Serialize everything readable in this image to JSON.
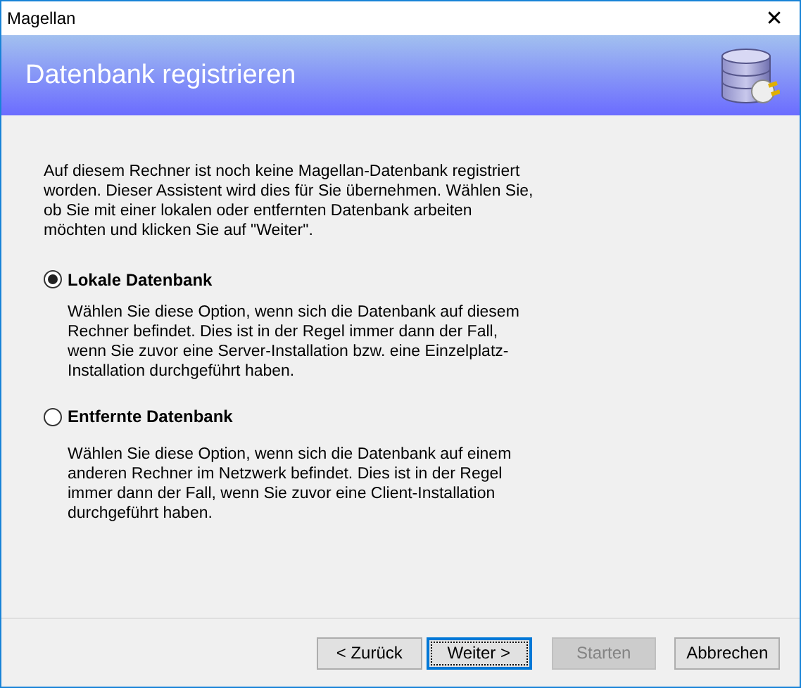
{
  "window": {
    "title": "Magellan",
    "close": "✕"
  },
  "header": {
    "title": "Datenbank registrieren"
  },
  "intro": "Auf diesem Rechner ist noch keine Magellan-Datenbank registriert worden. Dieser Assistent wird dies für Sie übernehmen. Wählen Sie, ob Sie mit einer lokalen oder entfernten Datenbank arbeiten möchten und klicken Sie auf \"Weiter\".",
  "options": [
    {
      "label": "Lokale Datenbank",
      "selected": true,
      "description": "Wählen Sie diese Option, wenn sich die Datenbank auf diesem Rechner befindet. Dies ist in der Regel immer dann der Fall, wenn Sie zuvor eine Server-Installation bzw. eine Einzelplatz-Installation durchgeführt haben."
    },
    {
      "label": "Entfernte Datenbank",
      "selected": false,
      "description": "Wählen Sie diese Option, wenn sich die Datenbank auf einem anderen Rechner im Netzwerk befindet. Dies ist in der Regel immer dann der Fall, wenn Sie zuvor eine Client-Installation durchgeführt haben."
    }
  ],
  "buttons": [
    {
      "label": "< Zurück",
      "disabled": false,
      "focused": false
    },
    {
      "label": "Weiter >",
      "disabled": false,
      "focused": true
    },
    {
      "label": "Starten",
      "disabled": true,
      "focused": false
    },
    {
      "label": "Abbrechen",
      "disabled": false,
      "focused": false
    }
  ]
}
